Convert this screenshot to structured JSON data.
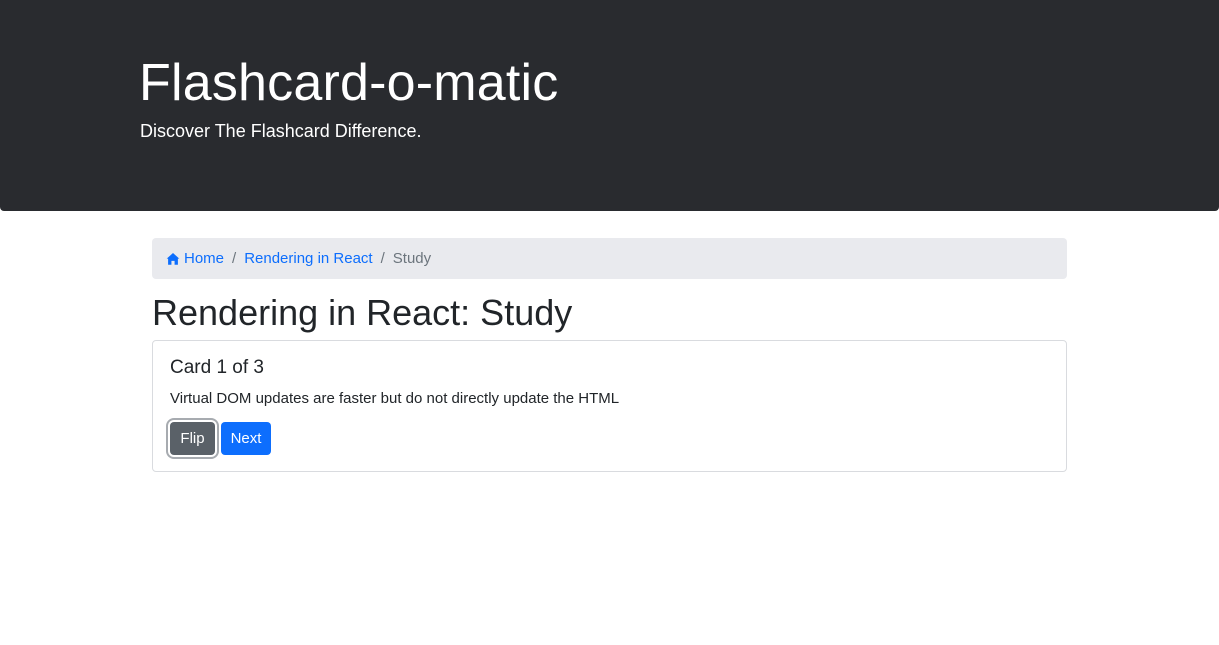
{
  "header": {
    "title": "Flashcard-o-matic",
    "subtitle": "Discover The Flashcard Difference."
  },
  "breadcrumb": {
    "home_label": "Home",
    "home_icon": "home-icon",
    "separator": "/",
    "deck_label": "Rendering in React",
    "active_label": "Study"
  },
  "page": {
    "title": "Rendering in React: Study"
  },
  "card": {
    "counter": "Card 1 of 3",
    "text": "Virtual DOM updates are faster but do not directly update the HTML",
    "flip_label": "Flip",
    "next_label": "Next"
  },
  "colors": {
    "header_bg": "#292b2f",
    "link": "#0d6efd",
    "secondary_button": "#5a6168",
    "primary_button": "#0d6efd",
    "breadcrumb_bg": "#e9eaee"
  }
}
